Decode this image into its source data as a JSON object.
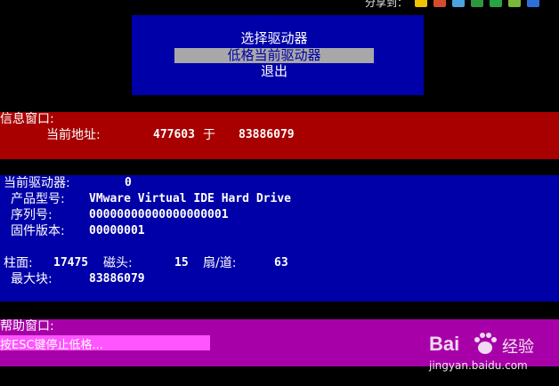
{
  "share": {
    "label": "分享到：",
    "icons": [
      {
        "name": "qzone-icon",
        "color": "#f2c200"
      },
      {
        "name": "renren-icon",
        "color": "#d54c2d"
      },
      {
        "name": "weibo-icon",
        "color": "#4aa3df"
      },
      {
        "name": "douban-icon",
        "color": "#2e963d"
      },
      {
        "name": "qq-icon",
        "color": "#26a545"
      },
      {
        "name": "tieba-icon",
        "color": "#79b83b"
      },
      {
        "name": "more-icon",
        "color": "#2f6fd8"
      }
    ]
  },
  "menu": {
    "items": [
      {
        "label": "选择驱动器",
        "selected": false
      },
      {
        "label": "低格当前驱动器",
        "selected": true
      },
      {
        "label": "退出",
        "selected": false
      }
    ]
  },
  "info": {
    "title": "信息窗口:",
    "address_label": "当前地址:",
    "address_value": "477603",
    "address_sep": "于",
    "address_total": "83886079"
  },
  "drive": {
    "current_label": "当前驱动器:",
    "current_value": "0",
    "model_label": "产品型号:",
    "model_value": "VMware Virtual IDE Hard Drive",
    "serial_label": "序列号:",
    "serial_value": "00000000000000000001",
    "firmware_label": "固件版本:",
    "firmware_value": "00000001",
    "cyl_label": "柱面:",
    "cyl_value": "17475",
    "head_label": "磁头:",
    "head_value": "15",
    "sector_label": "扇/道:",
    "sector_value": "63",
    "maxblock_label": "最大块:",
    "maxblock_value": "83886079"
  },
  "help": {
    "title": "帮助窗口:",
    "message": "按ESC键停止低格..."
  },
  "watermark": {
    "brand": "Bai",
    "brand2": "du",
    "text": "经验",
    "url": "jingyan.baidu.com"
  }
}
